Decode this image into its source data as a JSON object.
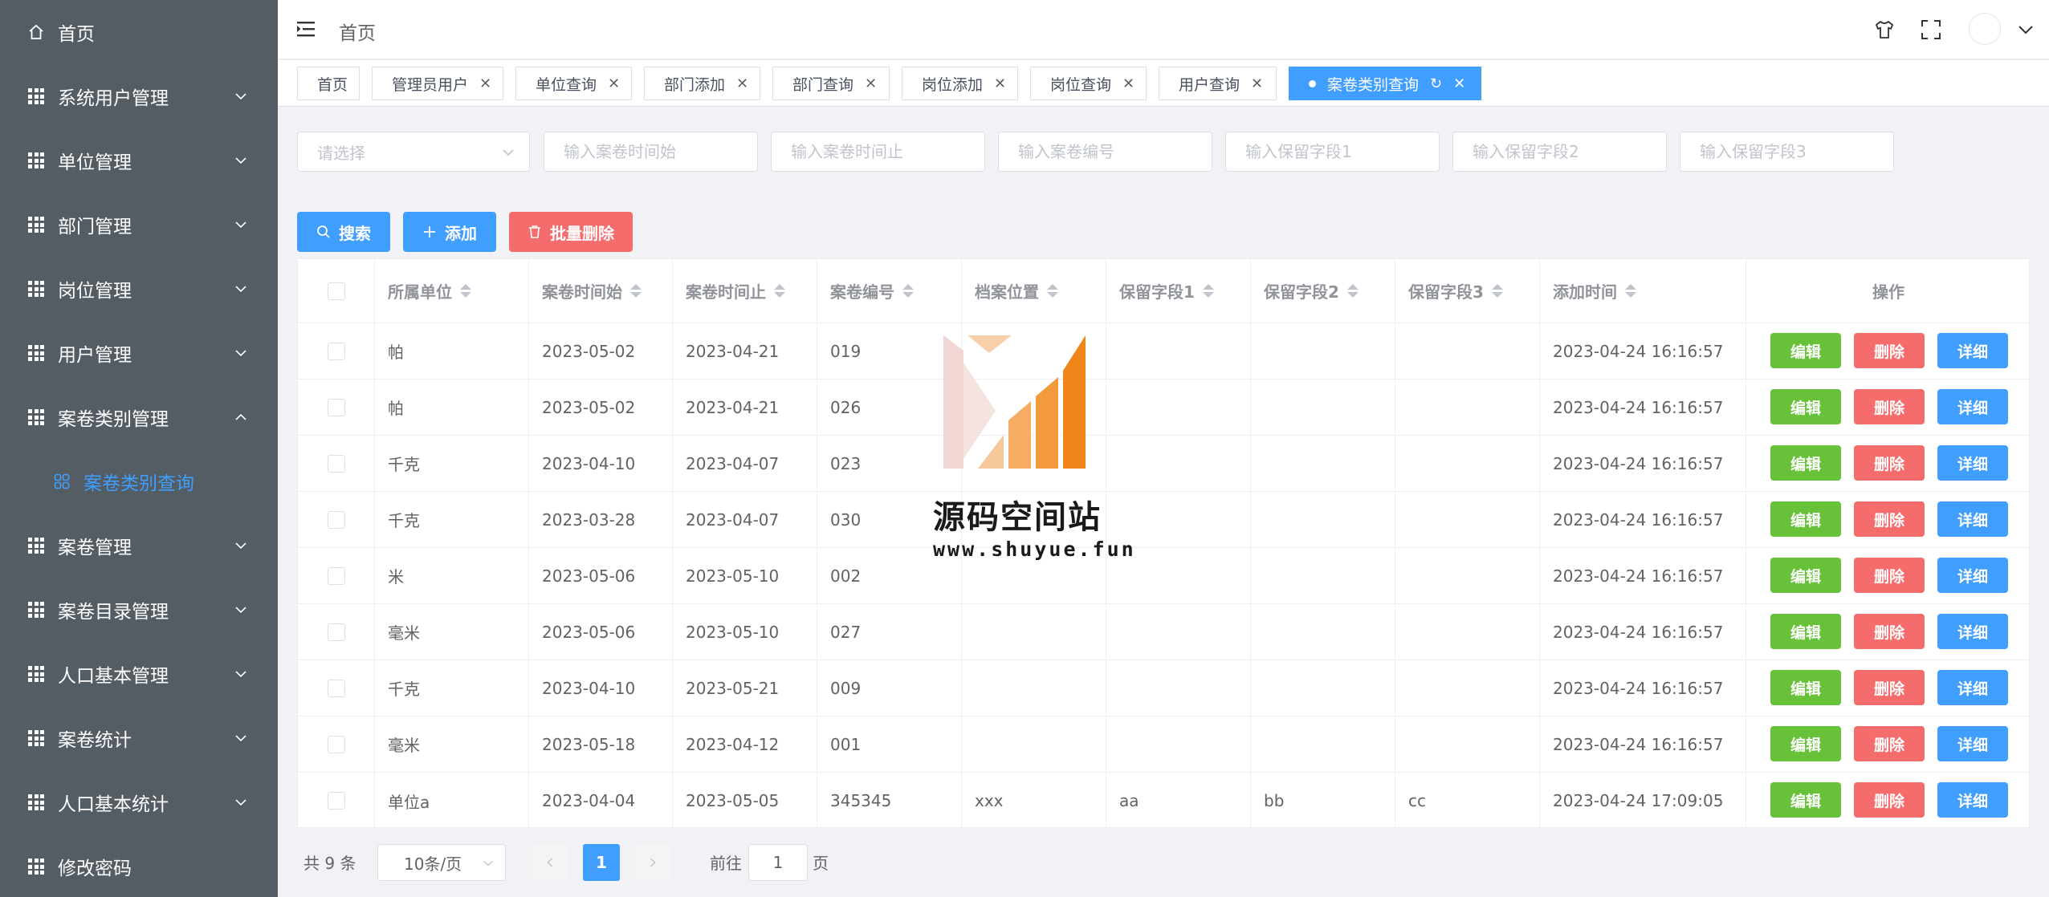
{
  "sidebar": {
    "items": [
      {
        "label": "首页",
        "icon": "home-icon",
        "arrow": ""
      },
      {
        "label": "系统用户管理",
        "icon": "grid-icon",
        "arrow": "down"
      },
      {
        "label": "单位管理",
        "icon": "grid-icon",
        "arrow": "down"
      },
      {
        "label": "部门管理",
        "icon": "grid-icon",
        "arrow": "down"
      },
      {
        "label": "岗位管理",
        "icon": "grid-icon",
        "arrow": "down"
      },
      {
        "label": "用户管理",
        "icon": "grid-icon",
        "arrow": "down"
      },
      {
        "label": "案卷类别管理",
        "icon": "grid-icon",
        "arrow": "up"
      },
      {
        "label": "案卷类别查询",
        "icon": "apps-icon",
        "arrow": ""
      },
      {
        "label": "案卷管理",
        "icon": "grid-icon",
        "arrow": "down"
      },
      {
        "label": "案卷目录管理",
        "icon": "grid-icon",
        "arrow": "down"
      },
      {
        "label": "人口基本管理",
        "icon": "grid-icon",
        "arrow": "down"
      },
      {
        "label": "案卷统计",
        "icon": "grid-icon",
        "arrow": "down"
      },
      {
        "label": "人口基本统计",
        "icon": "grid-icon",
        "arrow": "down"
      },
      {
        "label": "修改密码",
        "icon": "grid-icon",
        "arrow": ""
      }
    ]
  },
  "header": {
    "breadcrumb": "首页",
    "icons": [
      "skin-icon",
      "fullscreen-icon",
      "avatar",
      "chevron-down-icon"
    ]
  },
  "tags": [
    {
      "label": "首页",
      "closable": false,
      "active": false
    },
    {
      "label": "管理员用户",
      "closable": true,
      "active": false
    },
    {
      "label": "单位查询",
      "closable": true,
      "active": false
    },
    {
      "label": "部门添加",
      "closable": true,
      "active": false
    },
    {
      "label": "部门查询",
      "closable": true,
      "active": false
    },
    {
      "label": "岗位添加",
      "closable": true,
      "active": false
    },
    {
      "label": "岗位查询",
      "closable": true,
      "active": false
    },
    {
      "label": "用户查询",
      "closable": true,
      "active": false
    },
    {
      "label": "案卷类别查询",
      "closable": true,
      "active": true
    }
  ],
  "filters": {
    "select_placeholder": "请选择",
    "time_start_placeholder": "输入案卷时间始",
    "time_end_placeholder": "输入案卷时间止",
    "number_placeholder": "输入案卷编号",
    "field1_placeholder": "输入保留字段1",
    "field2_placeholder": "输入保留字段2",
    "field3_placeholder": "输入保留字段3"
  },
  "toolbar": {
    "search_label": "搜索",
    "add_label": "添加",
    "batch_delete_label": "批量删除"
  },
  "table": {
    "columns": [
      "所属单位",
      "案卷时间始",
      "案卷时间止",
      "案卷编号",
      "档案位置",
      "保留字段1",
      "保留字段2",
      "保留字段3",
      "添加时间",
      "操作"
    ],
    "rows": [
      [
        "帕",
        "2023-05-02",
        "2023-04-21",
        "019",
        "",
        "",
        "",
        "",
        "2023-04-24 16:16:57"
      ],
      [
        "帕",
        "2023-05-02",
        "2023-04-21",
        "026",
        "",
        "",
        "",
        "",
        "2023-04-24 16:16:57"
      ],
      [
        "千克",
        "2023-04-10",
        "2023-04-07",
        "023",
        "",
        "",
        "",
        "",
        "2023-04-24 16:16:57"
      ],
      [
        "千克",
        "2023-03-28",
        "2023-04-07",
        "030",
        "",
        "",
        "",
        "",
        "2023-04-24 16:16:57"
      ],
      [
        "米",
        "2023-05-06",
        "2023-05-10",
        "002",
        "",
        "",
        "",
        "",
        "2023-04-24 16:16:57"
      ],
      [
        "毫米",
        "2023-05-06",
        "2023-05-10",
        "027",
        "",
        "",
        "",
        "",
        "2023-04-24 16:16:57"
      ],
      [
        "千克",
        "2023-04-10",
        "2023-05-21",
        "009",
        "",
        "",
        "",
        "",
        "2023-04-24 16:16:57"
      ],
      [
        "毫米",
        "2023-05-18",
        "2023-04-12",
        "001",
        "",
        "",
        "",
        "",
        "2023-04-24 16:16:57"
      ],
      [
        "单位a",
        "2023-04-04",
        "2023-05-05",
        "345345",
        "xxx",
        "aa",
        "bb",
        "cc",
        "2023-04-24 17:09:05"
      ]
    ],
    "actions": {
      "edit": "编辑",
      "delete": "删除",
      "detail": "详细"
    }
  },
  "pagination": {
    "total_text": "共 9 条",
    "page_size": "10条/页",
    "current_page": "1",
    "goto_label": "前往",
    "goto_value": "1",
    "page_unit": "页"
  },
  "watermark": {
    "title": "源码空间站",
    "url": "www.shuyue.fun"
  },
  "colors": {
    "sidebar_bg": "#545c64",
    "primary": "#409eff",
    "success": "#67c23a",
    "danger": "#f56c6c"
  }
}
